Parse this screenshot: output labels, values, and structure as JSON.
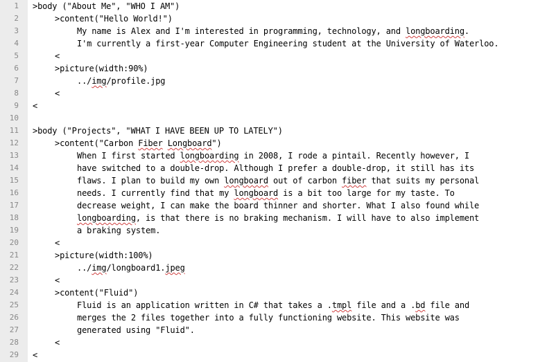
{
  "editor": {
    "lines": [
      {
        "num": "1",
        "indent": 0,
        "parts": [
          {
            "t": ">body (\"About Me\", \"WHO I AM\")"
          }
        ]
      },
      {
        "num": "2",
        "indent": 1,
        "parts": [
          {
            "t": ">content(\"Hello World!\")"
          }
        ]
      },
      {
        "num": "3",
        "indent": 2,
        "parts": [
          {
            "t": "My name is Alex and I'm interested in programming, technology, and "
          },
          {
            "t": "longboarding",
            "sq": true
          },
          {
            "t": "."
          }
        ]
      },
      {
        "num": "4",
        "indent": 2,
        "parts": [
          {
            "t": "I'm currently a first-year Computer Engineering student at the University of Waterloo."
          }
        ]
      },
      {
        "num": "5",
        "indent": 1,
        "parts": [
          {
            "t": "<"
          }
        ]
      },
      {
        "num": "6",
        "indent": 1,
        "parts": [
          {
            "t": ">picture(width:90%)"
          }
        ]
      },
      {
        "num": "7",
        "indent": 2,
        "parts": [
          {
            "t": "../"
          },
          {
            "t": "img",
            "sq": true
          },
          {
            "t": "/profile.jpg"
          }
        ]
      },
      {
        "num": "8",
        "indent": 1,
        "parts": [
          {
            "t": "<"
          }
        ]
      },
      {
        "num": "9",
        "indent": 0,
        "parts": [
          {
            "t": "<"
          }
        ]
      },
      {
        "num": "10",
        "indent": 0,
        "parts": []
      },
      {
        "num": "11",
        "indent": 0,
        "parts": [
          {
            "t": ">body (\"Projects\", \"WHAT I HAVE BEEN UP TO LATELY\")"
          }
        ]
      },
      {
        "num": "12",
        "indent": 1,
        "parts": [
          {
            "t": ">content(\"Carbon "
          },
          {
            "t": "Fiber",
            "sq": true
          },
          {
            "t": " "
          },
          {
            "t": "Longboard",
            "sq": true
          },
          {
            "t": "\")"
          }
        ]
      },
      {
        "num": "13",
        "indent": 2,
        "parts": [
          {
            "t": "When I first started "
          },
          {
            "t": "longboarding",
            "sq": true
          },
          {
            "t": " in 2008, I rode a pintail. Recently however, I"
          }
        ]
      },
      {
        "num": "14",
        "indent": 2,
        "parts": [
          {
            "t": "have switched to a double-drop. Although I prefer a double-drop, it still has its"
          }
        ]
      },
      {
        "num": "15",
        "indent": 2,
        "parts": [
          {
            "t": "flaws. I plan to build my own "
          },
          {
            "t": "longboard",
            "sq": true
          },
          {
            "t": " out of carbon "
          },
          {
            "t": "fiber",
            "sq": true
          },
          {
            "t": " that suits my personal"
          }
        ]
      },
      {
        "num": "16",
        "indent": 2,
        "parts": [
          {
            "t": "needs. I currently find that my "
          },
          {
            "t": "longboard",
            "sq": true
          },
          {
            "t": " is a bit too large for my taste. To"
          }
        ]
      },
      {
        "num": "17",
        "indent": 2,
        "parts": [
          {
            "t": "decrease weight, I can make the board thinner and shorter. What I also found while"
          }
        ]
      },
      {
        "num": "18",
        "indent": 2,
        "parts": [
          {
            "t": "longboarding",
            "sq": true
          },
          {
            "t": ", is that there is no braking mechanism. I will have to also implement"
          }
        ]
      },
      {
        "num": "19",
        "indent": 2,
        "parts": [
          {
            "t": "a braking system."
          }
        ]
      },
      {
        "num": "20",
        "indent": 1,
        "parts": [
          {
            "t": "<"
          }
        ]
      },
      {
        "num": "21",
        "indent": 1,
        "parts": [
          {
            "t": ">picture(width:100%)"
          }
        ]
      },
      {
        "num": "22",
        "indent": 2,
        "parts": [
          {
            "t": "../"
          },
          {
            "t": "img",
            "sq": true
          },
          {
            "t": "/longboard1."
          },
          {
            "t": "jpeg",
            "sq": true
          }
        ]
      },
      {
        "num": "23",
        "indent": 1,
        "parts": [
          {
            "t": "<"
          }
        ]
      },
      {
        "num": "24",
        "indent": 1,
        "parts": [
          {
            "t": ">content(\"Fluid\")"
          }
        ]
      },
      {
        "num": "25",
        "indent": 2,
        "parts": [
          {
            "t": "Fluid is an application written in C# that takes a ."
          },
          {
            "t": "tmpl",
            "sq": true
          },
          {
            "t": " file and a ."
          },
          {
            "t": "bd",
            "sq": true
          },
          {
            "t": " file and"
          }
        ]
      },
      {
        "num": "26",
        "indent": 2,
        "parts": [
          {
            "t": "merges the 2 files together into a fully functioning website. This website was"
          }
        ]
      },
      {
        "num": "27",
        "indent": 2,
        "parts": [
          {
            "t": "generated using \"Fluid\"."
          }
        ]
      },
      {
        "num": "28",
        "indent": 1,
        "parts": [
          {
            "t": "<"
          }
        ]
      },
      {
        "num": "29",
        "indent": 0,
        "parts": [
          {
            "t": "<"
          }
        ]
      }
    ]
  }
}
